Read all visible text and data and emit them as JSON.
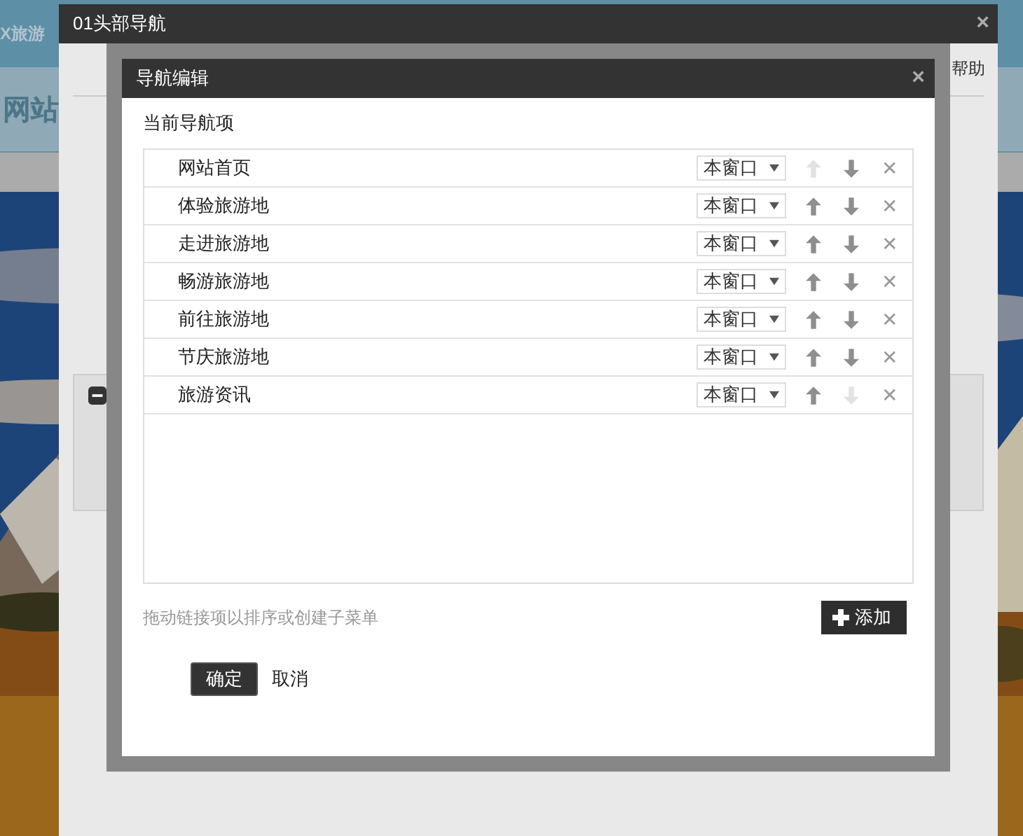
{
  "background_page": {
    "header_text": "X旅游",
    "nav_left": "网站",
    "kind": "picture"
  },
  "outer_dialog": {
    "title": "01头部导航",
    "close": "×",
    "help_link": "帮助"
  },
  "dialog": {
    "title": "导航编辑",
    "close": "×",
    "section_label": "当前导航项",
    "items": [
      {
        "label": "网站首页",
        "target": "本窗口",
        "up_disabled": true,
        "down_disabled": false,
        "remove": "✕"
      },
      {
        "label": "体验旅游地",
        "target": "本窗口",
        "up_disabled": false,
        "down_disabled": false,
        "remove": "✕"
      },
      {
        "label": "走进旅游地",
        "target": "本窗口",
        "up_disabled": false,
        "down_disabled": false,
        "remove": "✕"
      },
      {
        "label": "畅游旅游地",
        "target": "本窗口",
        "up_disabled": false,
        "down_disabled": false,
        "remove": "✕"
      },
      {
        "label": "前往旅游地",
        "target": "本窗口",
        "up_disabled": false,
        "down_disabled": false,
        "remove": "✕"
      },
      {
        "label": "节庆旅游地",
        "target": "本窗口",
        "up_disabled": false,
        "down_disabled": false,
        "remove": "✕"
      },
      {
        "label": "旅游资讯",
        "target": "本窗口",
        "up_disabled": false,
        "down_disabled": true,
        "remove": "✕"
      }
    ],
    "hint": "拖动链接项以排序或创建子菜单",
    "add_button": "添加",
    "buttons": [
      {
        "label": "确定",
        "kind": "primary"
      },
      {
        "label": "取消",
        "kind": "plain"
      }
    ]
  }
}
